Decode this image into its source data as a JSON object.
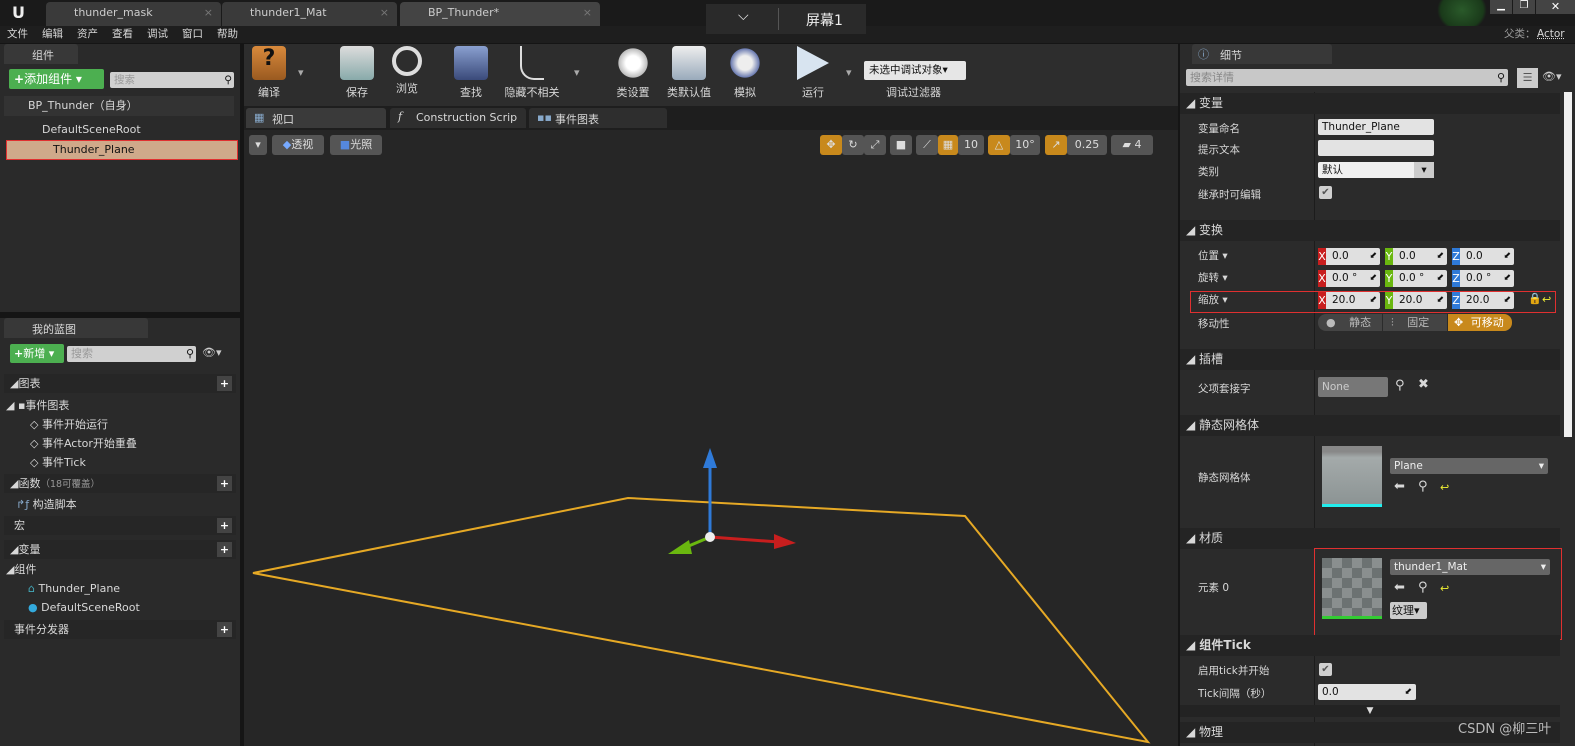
{
  "window": {
    "tabs": [
      {
        "label": "thunder_mask"
      },
      {
        "label": "thunder1_Mat"
      },
      {
        "label": "BP_Thunder*"
      }
    ],
    "overlay_label": "屏幕1",
    "parent_label": "父类：",
    "parent_value": "Actor"
  },
  "menu": [
    "文件",
    "编辑",
    "资产",
    "查看",
    "调试",
    "窗口",
    "帮助"
  ],
  "components": {
    "tab": "组件",
    "add_button": "添加组件",
    "search_placeholder": "搜索",
    "self": "BP_Thunder（自身）",
    "tree": [
      "DefaultSceneRoot",
      "Thunder_Plane"
    ]
  },
  "my_blueprint": {
    "tab": "我的蓝图",
    "new_button": "新增",
    "search_placeholder": "搜索",
    "sections": {
      "graphs": "图表",
      "event_graph": "事件图表",
      "events": [
        "事件开始运行",
        "事件Actor开始重叠",
        "事件Tick"
      ],
      "functions": "函数",
      "functions_note": "（18可覆盖）",
      "construction": "构造脚本",
      "macros": "宏",
      "variables": "变量",
      "components": "组件",
      "component_items": [
        "Thunder_Plane",
        "DefaultSceneRoot"
      ],
      "dispatchers": "事件分发器"
    }
  },
  "toolbar": {
    "buttons": [
      "编译",
      "保存",
      "浏览",
      "查找",
      "隐藏不相关",
      "类设置",
      "类默认值",
      "模拟",
      "运行"
    ],
    "debug_select": "未选中调试对象",
    "debug_filter": "调试过滤器"
  },
  "editor_tabs": [
    "视口",
    "Construction Scrip",
    "事件图表"
  ],
  "viewport": {
    "perspective": "透视",
    "lit": "光照",
    "grid_snap": "10",
    "rot_snap": "10°",
    "scale_snap": "0.25",
    "camera_speed": "4"
  },
  "details": {
    "tab": "细节",
    "search_placeholder": "搜索详情",
    "variable": {
      "header": "变量",
      "name_label": "变量命名",
      "name_value": "Thunder_Plane",
      "tooltip_label": "提示文本",
      "category_label": "类别",
      "category_value": "默认",
      "editable_label": "继承时可编辑",
      "editable_checked": true
    },
    "transform": {
      "header": "变换",
      "location_label": "位置",
      "rotation_label": "旋转",
      "scale_label": "缩放",
      "location": [
        "0.0",
        "0.0",
        "0.0"
      ],
      "rotation": [
        "0.0 °",
        "0.0 °",
        "0.0 °"
      ],
      "scale": [
        "20.0",
        "20.0",
        "20.0"
      ],
      "mobility_label": "移动性",
      "mobility_options": [
        "静态",
        "固定",
        "可移动"
      ],
      "mobility_selected": "可移动"
    },
    "sockets": {
      "header": "插槽",
      "parent_socket_label": "父项套接字",
      "parent_socket_value": "None"
    },
    "static_mesh": {
      "header": "静态网格体",
      "label": "静态网格体",
      "value": "Plane"
    },
    "materials": {
      "header": "材质",
      "element_label": "元素 0",
      "value": "thunder1_Mat",
      "texture_button": "纹理"
    },
    "tick": {
      "header": "组件Tick",
      "start_label": "启用tick并开始",
      "start_checked": true,
      "interval_label": "Tick间隔（秒）",
      "interval_value": "0.0"
    },
    "physics": {
      "header": "物理"
    }
  },
  "watermark": "CSDN @柳三叶",
  "colors": {
    "highlight": "#c8891c",
    "add_green": "#4caf50",
    "x_axis": "#c81e1e",
    "y_axis": "#6ab70f",
    "z_axis": "#2f7ad8",
    "selection": "#cfa98a",
    "plane_outline": "#e6a925"
  }
}
